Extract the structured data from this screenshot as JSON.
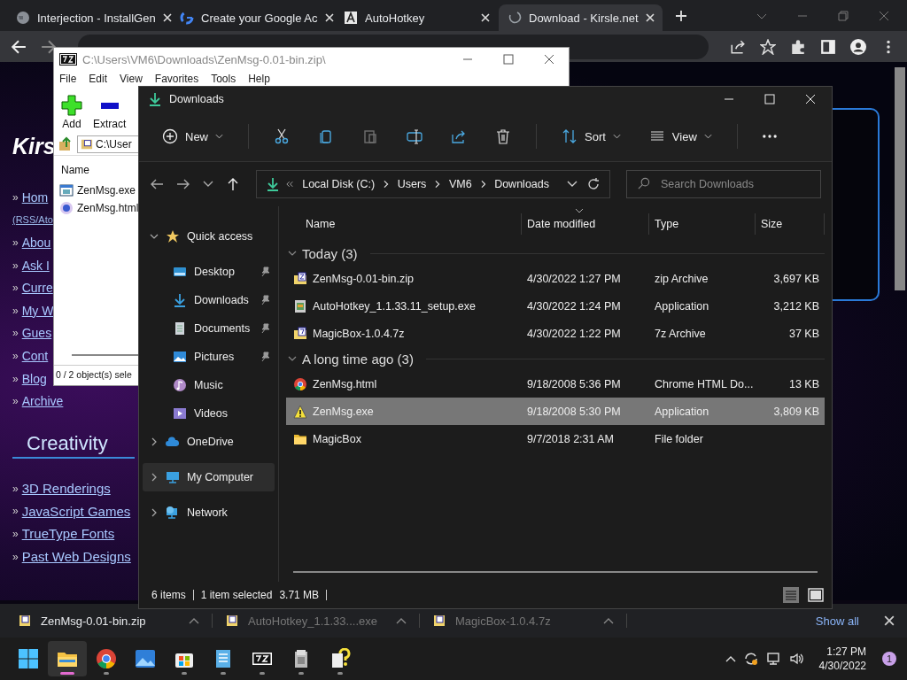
{
  "browser": {
    "tabs": [
      {
        "title": "Interjection - InstallGen",
        "kind": "globe",
        "selected": false
      },
      {
        "title": "Create your Google Ac",
        "kind": "google",
        "selected": false
      },
      {
        "title": "AutoHotkey",
        "kind": "letter",
        "selected": false
      },
      {
        "title": "Download - Kirsle.net",
        "kind": "loading",
        "selected": true
      }
    ]
  },
  "webpage": {
    "heading": "Kirs",
    "links": [
      {
        "bullet": "»",
        "text": "Hom",
        "kind": "link"
      },
      {
        "text": "(RSS/Ato",
        "kind": "note"
      },
      {
        "bullet": "»",
        "text": "Abou",
        "kind": "link"
      },
      {
        "bullet": "»",
        "text": "Ask I",
        "kind": "link"
      },
      {
        "bullet": "»",
        "text": "Curre",
        "kind": "link"
      },
      {
        "bullet": "»",
        "text": "My W",
        "kind": "link"
      },
      {
        "bullet": "»",
        "text": "Gues",
        "kind": "link"
      },
      {
        "bullet": "»",
        "text": "Cont",
        "kind": "link"
      },
      {
        "bullet": "»",
        "text": "Blog",
        "kind": "link"
      },
      {
        "bullet": "»",
        "text": "Archive",
        "kind": "link"
      }
    ],
    "section_title": "Creativity",
    "section_links": [
      {
        "bullet": "»",
        "text": "3D Renderings"
      },
      {
        "bullet": "»",
        "text": "JavaScript Games"
      },
      {
        "bullet": "»",
        "text": "TrueType Fonts"
      },
      {
        "bullet": "»",
        "text": "Past Web Designs"
      }
    ]
  },
  "downloads_shelf": {
    "items": [
      {
        "name": "ZenMsg-0.01-bin.zip",
        "dimmed": false
      },
      {
        "name": "AutoHotkey_1.1.33....exe",
        "dimmed": true
      },
      {
        "name": "MagicBox-1.0.4.7z",
        "dimmed": true
      }
    ],
    "show_all": "Show all"
  },
  "sevenzip": {
    "title": "C:\\Users\\VM6\\Downloads\\ZenMsg-0.01-bin.zip\\",
    "menu": [
      "File",
      "Edit",
      "View",
      "Favorites",
      "Tools",
      "Help"
    ],
    "toolbar": [
      {
        "label": "Add",
        "kind": "add"
      },
      {
        "label": "Extract",
        "kind": "extract"
      }
    ],
    "path": "C:\\User",
    "column": "Name",
    "files": [
      {
        "name": "ZenMsg.exe",
        "kind": "exe"
      },
      {
        "name": "ZenMsg.html",
        "kind": "html"
      }
    ],
    "status": "0 / 2 object(s) sele"
  },
  "explorer": {
    "title": "Downloads",
    "commands": [
      {
        "kind": "new",
        "label": "New",
        "disabled": false
      },
      {
        "kind": "cut",
        "disabled": false
      },
      {
        "kind": "copy",
        "disabled": false
      },
      {
        "kind": "paste",
        "disabled": true
      },
      {
        "kind": "rename",
        "disabled": false
      },
      {
        "kind": "share",
        "disabled": false
      },
      {
        "kind": "delete",
        "disabled": false
      },
      {
        "kind": "sort",
        "label": "Sort",
        "disabled": false
      },
      {
        "kind": "view",
        "label": "View",
        "disabled": false
      },
      {
        "kind": "more",
        "disabled": false
      }
    ],
    "breadcrumb": [
      "Local Disk (C:)",
      "Users",
      "VM6",
      "Downloads"
    ],
    "search": {
      "placeholder": "Search Downloads"
    },
    "nav": [
      {
        "label": "Quick access",
        "kind": "star",
        "expanded": true,
        "selected": false,
        "children": [
          {
            "label": "Desktop",
            "kind": "desktop",
            "pinned": true,
            "selected": false
          },
          {
            "label": "Downloads",
            "kind": "download",
            "pinned": true,
            "selected": false
          },
          {
            "label": "Documents",
            "kind": "document",
            "pinned": true,
            "selected": false
          },
          {
            "label": "Pictures",
            "kind": "picture",
            "pinned": true,
            "selected": false
          },
          {
            "label": "Music",
            "kind": "music",
            "pinned": false,
            "selected": false
          },
          {
            "label": "Videos",
            "kind": "video",
            "pinned": false,
            "selected": false
          }
        ]
      },
      {
        "label": "OneDrive",
        "kind": "cloud",
        "expanded": false,
        "selected": false
      },
      {
        "label": "My Computer",
        "kind": "computer",
        "expanded": false,
        "selected": true
      },
      {
        "label": "Network",
        "kind": "network",
        "expanded": false,
        "selected": false
      }
    ],
    "columns": [
      {
        "label": "Name",
        "sorted": false
      },
      {
        "label": "Date modified",
        "sorted": true
      },
      {
        "label": "Type",
        "sorted": false
      },
      {
        "label": "Size",
        "sorted": false
      }
    ],
    "groups": [
      {
        "title": "Today (3)",
        "expanded": true,
        "files": [
          {
            "name": "ZenMsg-0.01-bin.zip",
            "kind": "zip",
            "date": "4/30/2022 1:27 PM",
            "type": "zip Archive",
            "size": "3,697 KB",
            "selected": false
          },
          {
            "name": "AutoHotkey_1.1.33.11_setup.exe",
            "kind": "installer",
            "date": "4/30/2022 1:24 PM",
            "type": "Application",
            "size": "3,212 KB",
            "selected": false
          },
          {
            "name": "MagicBox-1.0.4.7z",
            "kind": "sevenzip",
            "date": "4/30/2022 1:22 PM",
            "type": "7z Archive",
            "size": "37 KB",
            "selected": false
          }
        ]
      },
      {
        "title": "A long time ago (3)",
        "expanded": true,
        "files": [
          {
            "name": "ZenMsg.html",
            "kind": "html",
            "date": "9/18/2008 5:36 PM",
            "type": "Chrome HTML Do...",
            "size": "13 KB",
            "selected": false
          },
          {
            "name": "ZenMsg.exe",
            "kind": "warning",
            "date": "9/18/2008 5:30 PM",
            "type": "Application",
            "size": "3,809 KB",
            "selected": true
          },
          {
            "name": "MagicBox",
            "kind": "folder",
            "date": "9/7/2018 2:31 AM",
            "type": "File folder",
            "selected": false
          }
        ]
      }
    ],
    "status": {
      "items": "6 items",
      "selection": "1 item selected",
      "selection_size": "3.71 MB"
    }
  },
  "taskbar": {
    "apps": [
      {
        "kind": "start",
        "active": false,
        "running": false
      },
      {
        "kind": "folder",
        "active": true,
        "running": true
      },
      {
        "kind": "browser",
        "active": false,
        "running": true
      },
      {
        "kind": "photos",
        "active": false,
        "running": false
      },
      {
        "kind": "store",
        "active": false,
        "running": true
      },
      {
        "kind": "notepad",
        "active": false,
        "running": true
      },
      {
        "kind": "archiver",
        "active": false,
        "running": true
      },
      {
        "kind": "installer",
        "active": false,
        "running": true
      },
      {
        "kind": "help",
        "active": false,
        "running": true
      }
    ],
    "time": "1:27 PM",
    "date": "4/30/2022",
    "notifications": "1"
  }
}
